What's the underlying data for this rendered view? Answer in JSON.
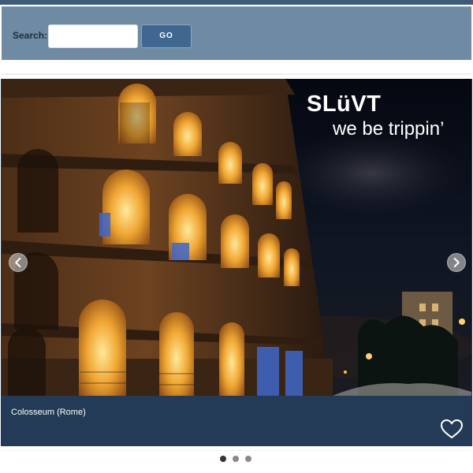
{
  "search": {
    "label": "Search:",
    "value": "",
    "placeholder": "",
    "button_label": "GO"
  },
  "slider": {
    "brand_name": "SLüVT",
    "tagline": "we be trippin’",
    "caption": "Colosseum (Rome)",
    "prev_icon": "chevron-left-icon",
    "next_icon": "chevron-right-icon",
    "favorite_icon": "heart-outline-icon",
    "pager": {
      "total": 3,
      "active_index": 0
    }
  },
  "colors": {
    "page_bg": "#ffffff",
    "header_strip": "#3e5b7a",
    "search_bar": "#6f8aa3",
    "go_button": "#3f6790",
    "caption_bar": "#233b56",
    "dot_active": "#333333",
    "dot_inactive": "#8a8a8a"
  }
}
